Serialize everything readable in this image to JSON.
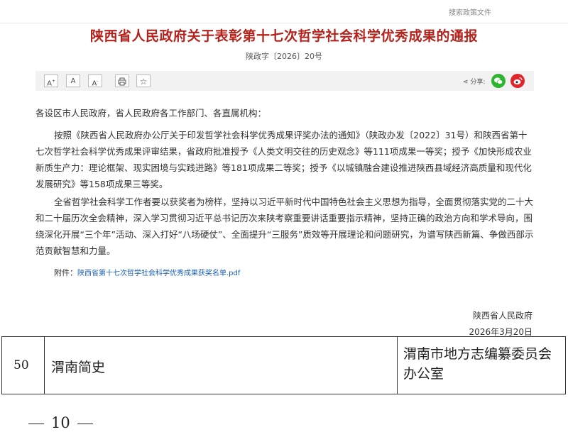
{
  "top_link": "搜索政策文件",
  "title": "陕西省人民政府关于表彰第十七次哲学社会科学优秀成果的通报",
  "doc_number": "陕政字〔2026〕20号",
  "toolbar": {
    "font_large": "A",
    "font_normal": "A",
    "font_small": "A",
    "share_label": "分享:"
  },
  "salutation": "各设区市人民政府，省人民政府各工作部门、各直属机构：",
  "paragraph1": "按照《陕西省人民政府办公厅关于印发哲学社会科学优秀成果评奖办法的通知》（陕政办发〔2022〕31号）和陕西省第十七次哲学社会科学优秀成果评审结果，省政府批准授予《人类文明交往的历史观念》等111项成果一等奖；授予《加快形成农业新质生产力：理论框架、现实困境与实践进路》等181项成果二等奖；授予《以城镇融合建设推进陕西县域经济高质量和现代化发展研究》等158项成果三等奖。",
  "paragraph2": "全省哲学社会科学工作者要以获奖者为榜样，坚持以习近平新时代中国特色社会主义思想为指导，全面贯彻落实党的二十大和二十届历次全会精神，深入学习贯彻习近平总书记历次来陕考察重要讲话重要指示精神，坚持正确的政治方向和学术导向，围绕深化开展“三个年”活动、深入打好“八场硬仗”、全面提升“三服务”质效等开展理论和问题研究，为谱写陕西新篇、争做西部示范贡献智慧和力量。",
  "attachment_label": "附件：",
  "attachment_link": "陕西省第十七次哲学社会科学优秀成果获奖名单.pdf",
  "signature": "陕西省人民政府",
  "date": "2026年3月20日",
  "table_row": {
    "number": "50",
    "title": "渭南简史",
    "organization": "渭南市地方志编纂委员会办公室"
  },
  "page_number": "10"
}
